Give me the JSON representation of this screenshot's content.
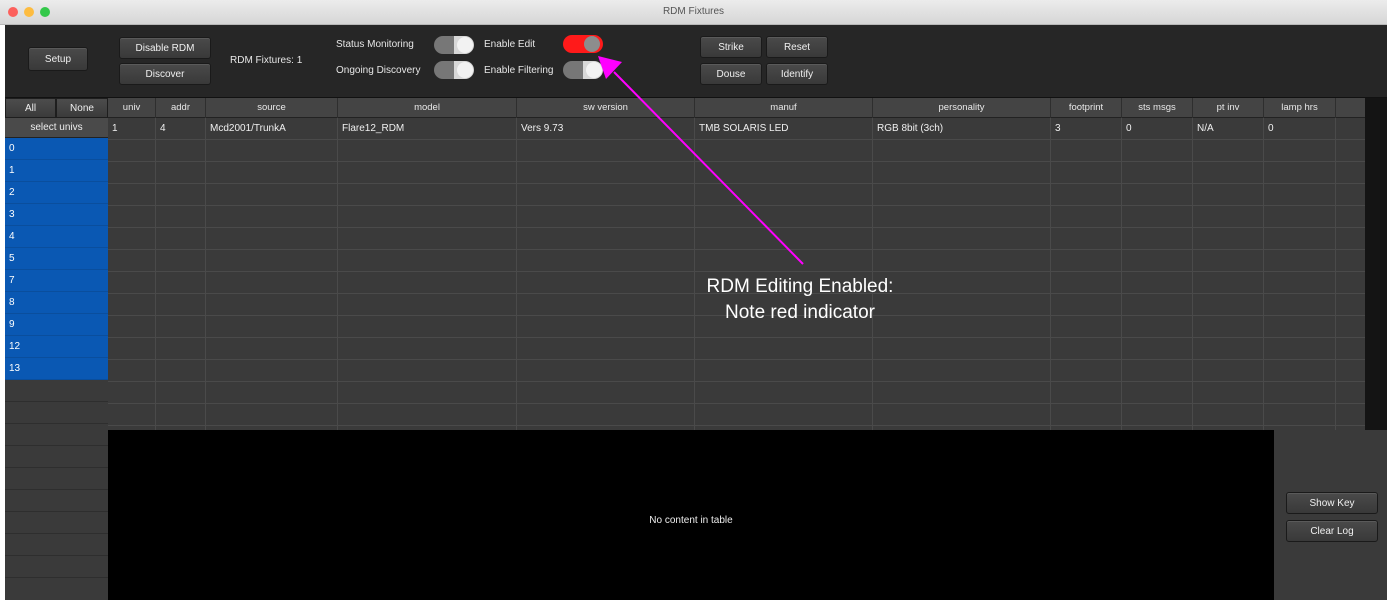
{
  "window": {
    "title": "RDM Fixtures"
  },
  "toolbar": {
    "setup_label": "Setup",
    "disable_rdm_label": "Disable RDM",
    "discover_label": "Discover",
    "rdm_fixtures_label": "RDM Fixtures:",
    "rdm_fixtures_count": "1",
    "status_monitoring_label": "Status Monitoring",
    "ongoing_discovery_label": "Ongoing Discovery",
    "enable_edit_label": "Enable Edit",
    "enable_filtering_label": "Enable Filtering",
    "toggles": {
      "status_monitoring": "off",
      "ongoing_discovery": "off",
      "enable_edit": "on",
      "enable_filtering": "off"
    },
    "enable_edit_color": "#ff1a1a",
    "strike_label": "Strike",
    "reset_label": "Reset",
    "douse_label": "Douse",
    "identify_label": "Identify"
  },
  "left_panel": {
    "all_label": "All",
    "none_label": "None",
    "header": "select univs",
    "universes": [
      "0",
      "1",
      "2",
      "3",
      "4",
      "5",
      "7",
      "8",
      "9",
      "12",
      "13"
    ],
    "selected_color": "#0a58b3"
  },
  "table": {
    "columns": [
      "univ",
      "addr",
      "source",
      "model",
      "sw version",
      "manuf",
      "personality",
      "footprint",
      "sts msgs",
      "pt inv",
      "lamp hrs"
    ],
    "rows": [
      [
        "1",
        "4",
        "Mcd2001/TrunkA",
        "Flare12_RDM",
        "Vers 9.73",
        "TMB SOLARIS LED",
        "RGB 8bit (3ch)",
        "3",
        "0",
        "N/A",
        "0"
      ]
    ]
  },
  "log": {
    "empty_text": "No content in table",
    "show_key_label": "Show Key",
    "clear_log_label": "Clear Log"
  },
  "annotation": {
    "line1": "RDM Editing Enabled:",
    "line2": "Note red indicator",
    "arrow_color": "#ff00ff"
  }
}
